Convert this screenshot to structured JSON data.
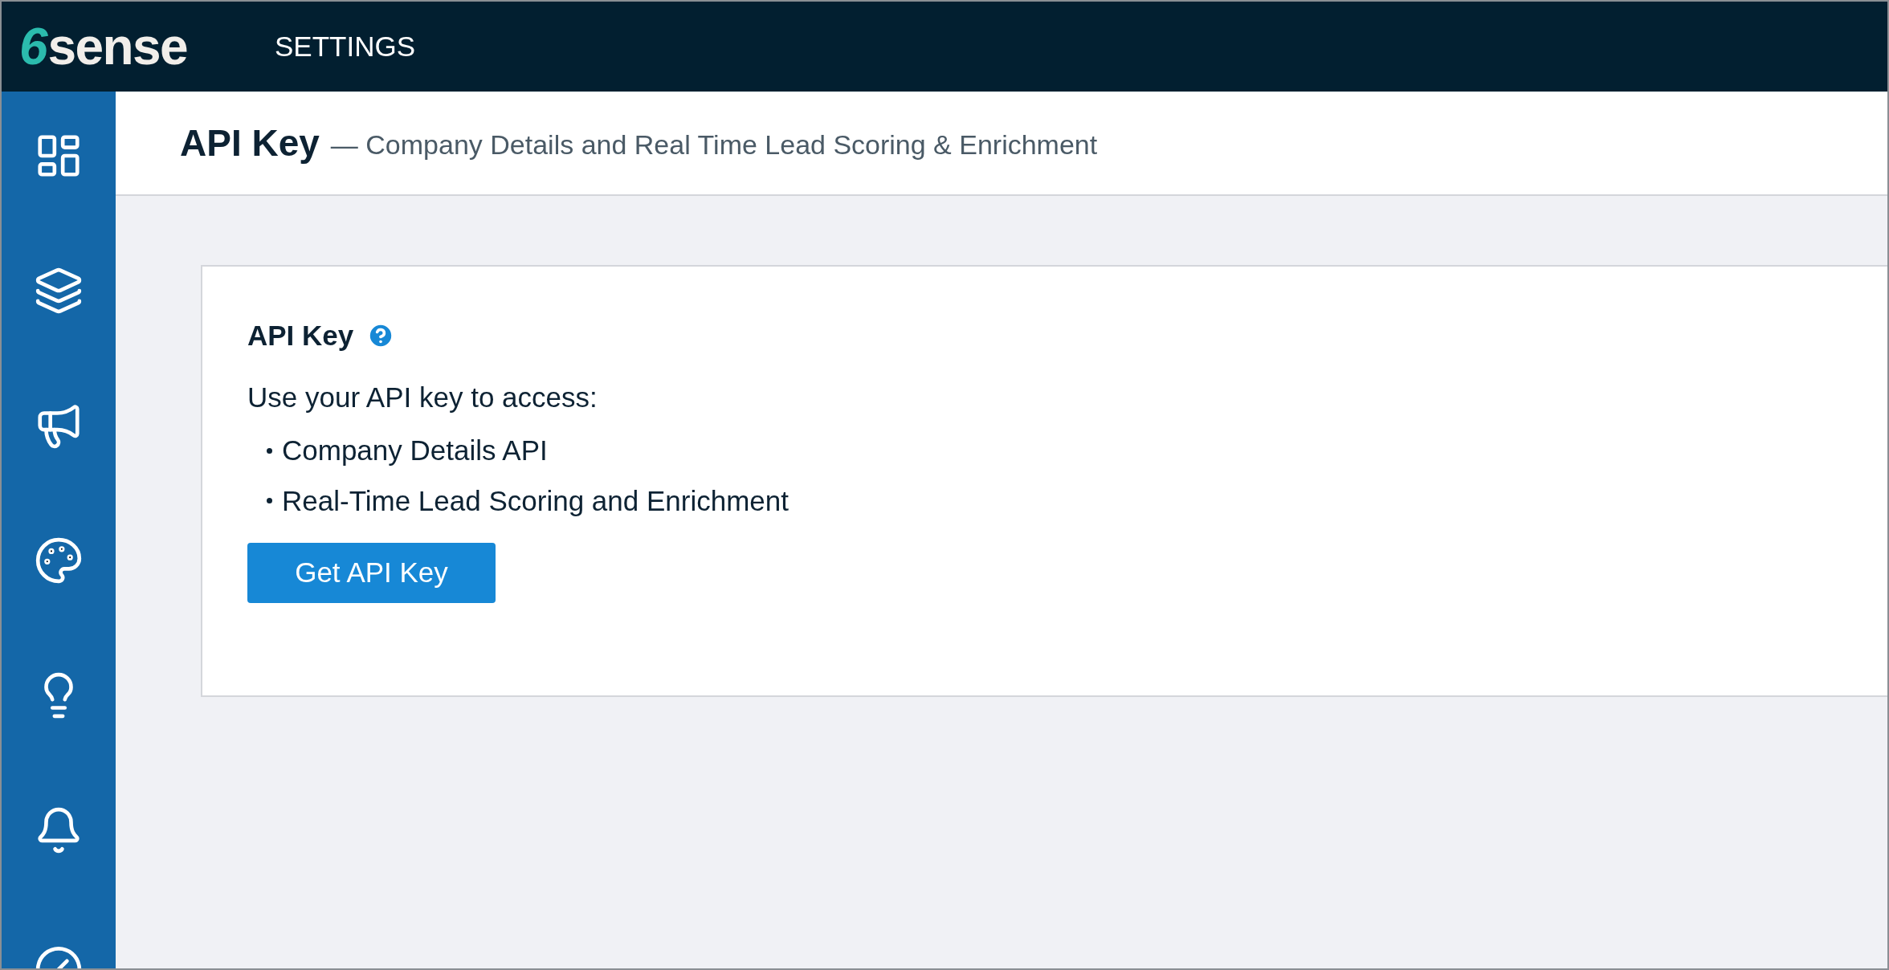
{
  "topbar": {
    "logo": {
      "mark": "6",
      "text": "sense"
    },
    "title": "SETTINGS"
  },
  "header": {
    "title": "API Key",
    "subtitle": "— Company Details and Real Time Lead Scoring & Enrichment"
  },
  "card": {
    "title": "API Key",
    "intro": "Use your API key to access:",
    "items": [
      "Company Details API",
      "Real-Time Lead Scoring and Enrichment"
    ],
    "button": "Get API Key"
  }
}
